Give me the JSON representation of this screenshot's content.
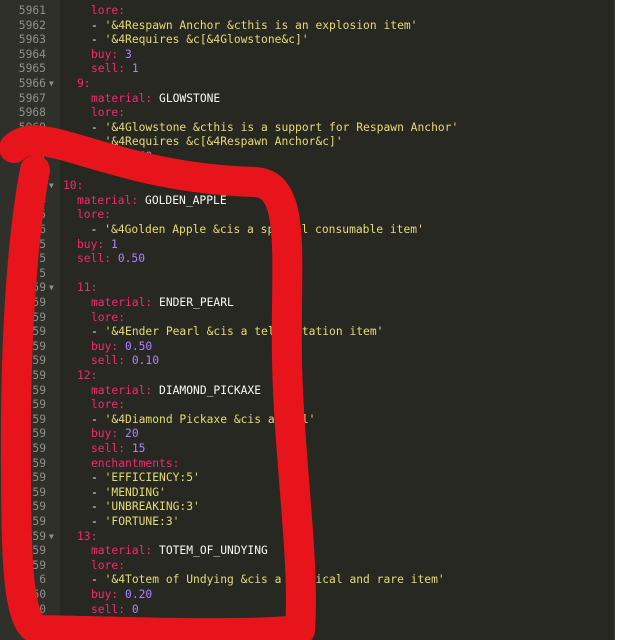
{
  "editor": {
    "colors": {
      "background": "#272822",
      "gutter": "#2f302a",
      "line_number": "#8f908a",
      "key": "#f92672",
      "string": "#e6db74",
      "number": "#ae81ff",
      "plain": "#f8f8f2",
      "annotation": "#e8141b"
    },
    "lines": [
      {
        "no": "5961",
        "fold": "",
        "indent": 2,
        "parts": [
          {
            "t": "lore:",
            "c": "k"
          }
        ]
      },
      {
        "no": "5962",
        "fold": "",
        "indent": 2,
        "parts": [
          {
            "t": "- ",
            "c": "p"
          },
          {
            "t": "'&4Respawn Anchor &cthis is an explosion item'",
            "c": "s"
          }
        ]
      },
      {
        "no": "5963",
        "fold": "",
        "indent": 2,
        "parts": [
          {
            "t": "- ",
            "c": "p"
          },
          {
            "t": "'&4Requires &c[&4Glowstone&c]'",
            "c": "s"
          }
        ]
      },
      {
        "no": "5964",
        "fold": "",
        "indent": 2,
        "parts": [
          {
            "t": "buy: ",
            "c": "k"
          },
          {
            "t": "3",
            "c": "n"
          }
        ]
      },
      {
        "no": "5965",
        "fold": "",
        "indent": 2,
        "parts": [
          {
            "t": "sell: ",
            "c": "k"
          },
          {
            "t": "1",
            "c": "n"
          }
        ]
      },
      {
        "no": "5966",
        "fold": "▼",
        "indent": 1,
        "parts": [
          {
            "t": "9:",
            "c": "k"
          }
        ]
      },
      {
        "no": "5967",
        "fold": "",
        "indent": 2,
        "parts": [
          {
            "t": "material: ",
            "c": "k"
          },
          {
            "t": "GLOWSTONE",
            "c": "w"
          }
        ]
      },
      {
        "no": "5968",
        "fold": "",
        "indent": 2,
        "parts": [
          {
            "t": "lore:",
            "c": "k"
          }
        ]
      },
      {
        "no": "5969",
        "fold": "",
        "indent": 2,
        "parts": [
          {
            "t": "- ",
            "c": "p"
          },
          {
            "t": "'&4Glowstone &cthis is a support for Respawn Anchor'",
            "c": "s"
          }
        ]
      },
      {
        "no": "0",
        "fold": "",
        "indent": 2,
        "parts": [
          {
            "t": "- ",
            "c": "p"
          },
          {
            "t": "'&4Requires &c[&4Respawn Anchor&c]'",
            "c": "s"
          }
        ]
      },
      {
        "no": "1",
        "fold": "",
        "indent": 2,
        "parts": [
          {
            "t": "buy: ",
            "c": "k"
          },
          {
            "t": "2.50",
            "c": "n"
          }
        ]
      },
      {
        "no": "2",
        "fold": "",
        "indent": 0,
        "parts": []
      },
      {
        "no": "3",
        "fold": "▼",
        "indent": 0,
        "parts": [
          {
            "t": "10:",
            "c": "k"
          }
        ]
      },
      {
        "no": "4",
        "fold": "",
        "indent": 1,
        "parts": [
          {
            "t": "material: ",
            "c": "k"
          },
          {
            "t": "GOLDEN_APPLE",
            "c": "w"
          }
        ]
      },
      {
        "no": "5",
        "fold": "",
        "indent": 1,
        "parts": [
          {
            "t": "lore:",
            "c": "k"
          }
        ]
      },
      {
        "no": "6",
        "fold": "",
        "indent": 1,
        "parts": [
          {
            "t": "  - ",
            "c": "p"
          },
          {
            "t": "'&4Golden Apple &cis a special consumable item'",
            "c": "s"
          }
        ]
      },
      {
        "no": "5",
        "fold": "",
        "indent": 1,
        "parts": [
          {
            "t": "buy: ",
            "c": "k"
          },
          {
            "t": "1",
            "c": "n"
          }
        ]
      },
      {
        "no": "5",
        "fold": "",
        "indent": 1,
        "parts": [
          {
            "t": "sell: ",
            "c": "k"
          },
          {
            "t": "0.50",
            "c": "n"
          }
        ]
      },
      {
        "no": "5",
        "fold": "",
        "indent": 0,
        "parts": []
      },
      {
        "no": "59",
        "fold": "▼",
        "indent": 1,
        "parts": [
          {
            "t": "11:",
            "c": "k"
          }
        ]
      },
      {
        "no": "59",
        "fold": "",
        "indent": 2,
        "parts": [
          {
            "t": "material: ",
            "c": "k"
          },
          {
            "t": "ENDER_PEARL",
            "c": "w"
          }
        ]
      },
      {
        "no": "59",
        "fold": "",
        "indent": 2,
        "parts": [
          {
            "t": "lore:",
            "c": "k"
          }
        ]
      },
      {
        "no": "59",
        "fold": "",
        "indent": 2,
        "parts": [
          {
            "t": "- ",
            "c": "p"
          },
          {
            "t": "'&4Ender Pearl &cis a teleportation item'",
            "c": "s"
          }
        ]
      },
      {
        "no": "59",
        "fold": "",
        "indent": 2,
        "parts": [
          {
            "t": "buy: ",
            "c": "k"
          },
          {
            "t": "0.50",
            "c": "n"
          }
        ]
      },
      {
        "no": "59",
        "fold": "",
        "indent": 2,
        "parts": [
          {
            "t": "sell: ",
            "c": "k"
          },
          {
            "t": "0.10",
            "c": "n"
          }
        ]
      },
      {
        "no": "59",
        "fold": "",
        "indent": 1,
        "parts": [
          {
            "t": "12:",
            "c": "k"
          }
        ]
      },
      {
        "no": "59",
        "fold": "",
        "indent": 2,
        "parts": [
          {
            "t": "material: ",
            "c": "k"
          },
          {
            "t": "DIAMOND_PICKAXE",
            "c": "w"
          }
        ]
      },
      {
        "no": "59",
        "fold": "",
        "indent": 2,
        "parts": [
          {
            "t": "lore:",
            "c": "k"
          }
        ]
      },
      {
        "no": "59",
        "fold": "",
        "indent": 2,
        "parts": [
          {
            "t": "- ",
            "c": "p"
          },
          {
            "t": "'&4Diamond Pickaxe &cis a tool'",
            "c": "s"
          }
        ]
      },
      {
        "no": "59",
        "fold": "",
        "indent": 2,
        "parts": [
          {
            "t": "buy: ",
            "c": "k"
          },
          {
            "t": "20",
            "c": "n"
          }
        ]
      },
      {
        "no": "59",
        "fold": "",
        "indent": 2,
        "parts": [
          {
            "t": "sell: ",
            "c": "k"
          },
          {
            "t": "15",
            "c": "n"
          }
        ]
      },
      {
        "no": "59",
        "fold": "",
        "indent": 2,
        "parts": [
          {
            "t": "enchantments:",
            "c": "k"
          }
        ]
      },
      {
        "no": "59",
        "fold": "",
        "indent": 2,
        "parts": [
          {
            "t": "- ",
            "c": "p"
          },
          {
            "t": "'EFFICIENCY:5'",
            "c": "s"
          }
        ]
      },
      {
        "no": "59",
        "fold": "",
        "indent": 2,
        "parts": [
          {
            "t": "- ",
            "c": "p"
          },
          {
            "t": "'MENDING'",
            "c": "s"
          }
        ]
      },
      {
        "no": "59",
        "fold": "",
        "indent": 2,
        "parts": [
          {
            "t": "- ",
            "c": "p"
          },
          {
            "t": "'UNBREAKING:3'",
            "c": "s"
          }
        ]
      },
      {
        "no": "59",
        "fold": "",
        "indent": 2,
        "parts": [
          {
            "t": "- ",
            "c": "p"
          },
          {
            "t": "'FORTUNE:3'",
            "c": "s"
          }
        ]
      },
      {
        "no": "59",
        "fold": "▼",
        "indent": 1,
        "parts": [
          {
            "t": "13:",
            "c": "k"
          }
        ]
      },
      {
        "no": "59",
        "fold": "",
        "indent": 2,
        "parts": [
          {
            "t": "material: ",
            "c": "k"
          },
          {
            "t": "TOTEM_OF_UNDYING",
            "c": "w"
          }
        ]
      },
      {
        "no": "59",
        "fold": "",
        "indent": 2,
        "parts": [
          {
            "t": "lore:",
            "c": "k"
          }
        ]
      },
      {
        "no": "6",
        "fold": "",
        "indent": 2,
        "parts": [
          {
            "t": "- ",
            "c": "p"
          },
          {
            "t": "'&4Totem of Undying &cis a mythical and rare item'",
            "c": "s"
          }
        ]
      },
      {
        "no": "60",
        "fold": "",
        "indent": 2,
        "parts": [
          {
            "t": "buy: ",
            "c": "k"
          },
          {
            "t": "0.20",
            "c": "n"
          }
        ]
      },
      {
        "no": "600",
        "fold": "",
        "indent": 2,
        "parts": [
          {
            "t": "sell: ",
            "c": "k"
          },
          {
            "t": "0",
            "c": "n"
          }
        ]
      }
    ]
  }
}
